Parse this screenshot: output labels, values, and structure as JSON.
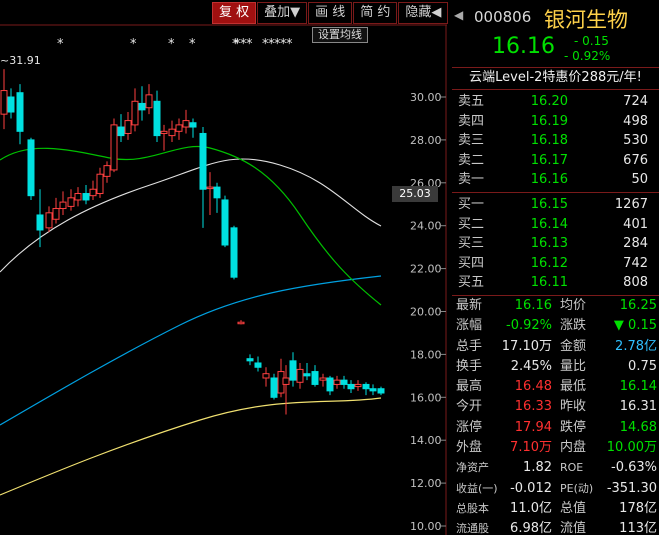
{
  "toolbar": {
    "buttons": [
      "复 权",
      "叠加▼",
      "画 线",
      "简 约",
      "隐藏◀"
    ],
    "ma_settings": "设置均线"
  },
  "chart": {
    "high_marker": "~31.91",
    "current_price_tag": "25.03",
    "event_marks": [
      "*",
      "*",
      "*",
      "*",
      "*",
      "*",
      "*",
      "*",
      "*",
      "*",
      "*",
      "*",
      "*"
    ],
    "y_ticks": [
      "30.00",
      "28.00",
      "26.00",
      "24.00",
      "22.00",
      "20.00",
      "18.00",
      "16.00",
      "14.00",
      "12.00",
      "10.00"
    ],
    "colors": {
      "up": "#ff4040",
      "down": "#00e0e0",
      "ma5": "#ffffff",
      "ma10": "#00c000",
      "ma20": "#00a0e0",
      "ma60": "#f0e070"
    }
  },
  "quote": {
    "code": "000806",
    "name": "银河生物",
    "last": "16.16",
    "change": "- 0.15",
    "change_pct": "- 0.92%",
    "promo": "云端Level-2特惠价288元/年!"
  },
  "order_book": {
    "asks": [
      {
        "label": "卖五",
        "price": "16.20",
        "vol": "724"
      },
      {
        "label": "卖四",
        "price": "16.19",
        "vol": "498"
      },
      {
        "label": "卖三",
        "price": "16.18",
        "vol": "530"
      },
      {
        "label": "卖二",
        "price": "16.17",
        "vol": "676"
      },
      {
        "label": "卖一",
        "price": "16.16",
        "vol": "50"
      }
    ],
    "bids": [
      {
        "label": "买一",
        "price": "16.15",
        "vol": "1267"
      },
      {
        "label": "买二",
        "price": "16.14",
        "vol": "401"
      },
      {
        "label": "买三",
        "price": "16.13",
        "vol": "284"
      },
      {
        "label": "买四",
        "price": "16.12",
        "vol": "742"
      },
      {
        "label": "买五",
        "price": "16.11",
        "vol": "808"
      }
    ]
  },
  "stats": [
    {
      "l1": "最新",
      "v1": "16.16",
      "c1": "c-grn",
      "l2": "均价",
      "v2": "16.25",
      "c2": "c-grn"
    },
    {
      "l1": "涨幅",
      "v1": "-0.92%",
      "c1": "c-grn",
      "l2": "涨跌",
      "v2": "▼ 0.15",
      "c2": "c-grn"
    },
    {
      "l1": "总手",
      "v1": "17.10万",
      "c1": "c-wht",
      "l2": "金额",
      "v2": "2.78亿",
      "c2": "c-cyan"
    },
    {
      "l1": "换手",
      "v1": "2.45%",
      "c1": "c-wht",
      "l2": "量比",
      "v2": "0.75",
      "c2": "c-wht"
    },
    {
      "l1": "最高",
      "v1": "16.48",
      "c1": "c-red",
      "l2": "最低",
      "v2": "16.14",
      "c2": "c-grn"
    },
    {
      "l1": "今开",
      "v1": "16.33",
      "c1": "c-red",
      "l2": "昨收",
      "v2": "16.31",
      "c2": "c-wht"
    },
    {
      "l1": "涨停",
      "v1": "17.94",
      "c1": "c-red",
      "l2": "跌停",
      "v2": "14.68",
      "c2": "c-grn"
    },
    {
      "l1": "外盘",
      "v1": "7.10万",
      "c1": "c-red",
      "l2": "内盘",
      "v2": "10.00万",
      "c2": "c-grn"
    },
    {
      "l1": "净资产",
      "v1": "1.82",
      "c1": "c-wht",
      "l2": "ROE",
      "v2": "-0.63%",
      "c2": "c-wht"
    },
    {
      "l1": "收益(一)",
      "v1": "-0.012",
      "c1": "c-wht",
      "l2": "PE(动)",
      "v2": "-351.30",
      "c2": "c-wht"
    },
    {
      "l1": "总股本",
      "v1": "11.0亿",
      "c1": "c-wht",
      "l2": "总值",
      "v2": "178亿",
      "c2": "c-wht"
    },
    {
      "l1": "流通股",
      "v1": "6.98亿",
      "c1": "c-wht",
      "l2": "流值",
      "v2": "113亿",
      "c2": "c-wht"
    }
  ]
}
